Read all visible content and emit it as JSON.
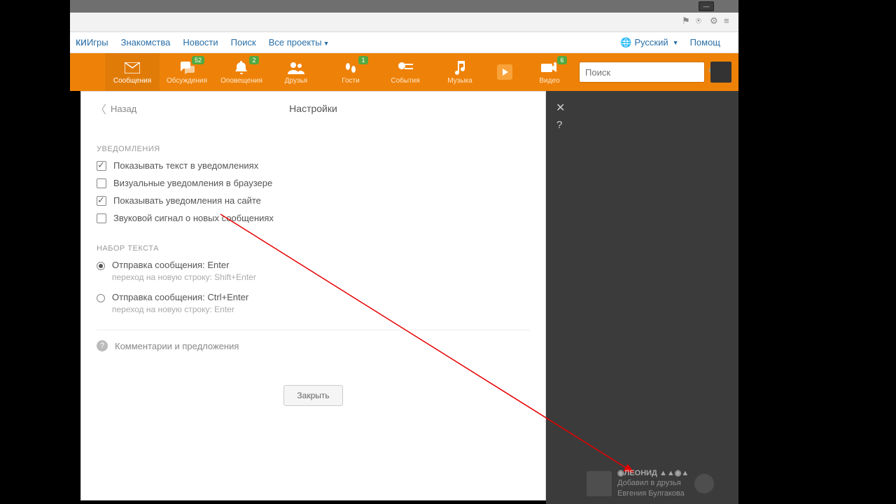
{
  "browser": {
    "minimize": "—"
  },
  "topnav": {
    "truncated": "ки",
    "items": [
      "Игры",
      "Знакомства",
      "Новости",
      "Поиск",
      "Все проекты"
    ],
    "language": "Русский",
    "help": "Помощ"
  },
  "orange": {
    "items": [
      {
        "key": "messages",
        "label": "Сообщения",
        "badge": null
      },
      {
        "key": "discussions",
        "label": "Обсуждения",
        "badge": "52"
      },
      {
        "key": "alerts",
        "label": "Оповещения",
        "badge": "2"
      },
      {
        "key": "friends",
        "label": "Друзья",
        "badge": null
      },
      {
        "key": "guests",
        "label": "Гости",
        "badge": "1"
      },
      {
        "key": "events",
        "label": "События",
        "badge": null
      },
      {
        "key": "music",
        "label": "Музыка",
        "badge": null
      },
      {
        "key": "play",
        "label": "",
        "badge": null
      },
      {
        "key": "video",
        "label": "Видео",
        "badge": "6"
      }
    ],
    "search_placeholder": "Поиск"
  },
  "panel": {
    "back": "Назад",
    "title": "Настройки",
    "section_notifications": "УВЕДОМЛЕНИЯ",
    "notif_opts": [
      {
        "label": "Показывать текст в уведомлениях",
        "checked": true
      },
      {
        "label": "Визуальные уведомления в браузере",
        "checked": false
      },
      {
        "label": "Показывать уведомления на сайте",
        "checked": true
      },
      {
        "label": "Звуковой сигнал о новых сообщениях",
        "checked": false
      }
    ],
    "section_typing": "НАБОР ТЕКСТА",
    "typing_opts": [
      {
        "label": "Отправка сообщения: Enter",
        "sub": "переход на новую строку: Shift+Enter",
        "checked": true
      },
      {
        "label": "Отправка сообщения: Ctrl+Enter",
        "sub": "переход на новую строку: Enter",
        "checked": false
      }
    ],
    "feedback": "Комментарии и предложения",
    "close": "Закрыть"
  },
  "overlay": {
    "close": "✕",
    "help": "?"
  },
  "feed": {
    "name": "◉ЛЕОНИД ▲▲◉▲",
    "action": "Добавил в друзья",
    "whom": "Евгения Булгакова"
  }
}
